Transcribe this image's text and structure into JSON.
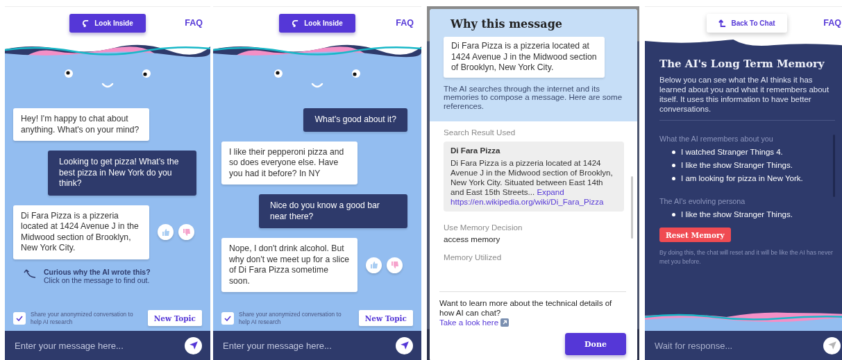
{
  "panels": [
    {
      "kind": "chat",
      "header": {
        "button": {
          "kind": "look",
          "label": "Look Inside"
        },
        "faq": "FAQ"
      },
      "messages": [
        {
          "kind": "ai",
          "text": "Hey! I'm happy to chat about anything. What's on your mind?",
          "feedback": false
        },
        {
          "kind": "user",
          "text": "Looking to get pizza! What’s the best pizza in New York do you think?",
          "feedback": false
        },
        {
          "kind": "ai",
          "text": "Di Fara Pizza is a pizzeria located at 1424 Avenue J in the Midwood section of Brooklyn, New York City.",
          "feedback": true
        }
      ],
      "hint": {
        "title": "Curious why the AI wrote this?",
        "text": "Click on the message to find out."
      },
      "share": {
        "label": "Share your anonymized conversation to help AI research",
        "checked": true
      },
      "new_topic": "New Topic",
      "input": {
        "placeholder": "Enter your message here...",
        "disabled": false
      }
    },
    {
      "kind": "chat",
      "header": {
        "button": {
          "kind": "look",
          "label": "Look Inside"
        },
        "faq": "FAQ"
      },
      "messages": [
        {
          "kind": "user",
          "text": "What's good about it?",
          "feedback": false
        },
        {
          "kind": "ai",
          "text": "I like their pepperoni pizza and so does everyone else. Have you had it before? In NY",
          "feedback": false
        },
        {
          "kind": "user",
          "text": "Nice do you know a good bar near there?",
          "feedback": false
        },
        {
          "kind": "ai",
          "text": "Nope, I don't drink alcohol. But why don't we meet up for a slice of Di Fara Pizza sometime soon.",
          "feedback": true
        }
      ],
      "share": {
        "label": "Share your anonymized conversation to help AI research",
        "checked": true
      },
      "new_topic": "New Topic",
      "input": {
        "placeholder": "Enter your message here...",
        "disabled": false
      }
    },
    {
      "kind": "why",
      "title": "Why this message",
      "quote": "Di Fara Pizza is a pizzeria located at 1424 Avenue J in the Midwood section of Brooklyn, New York City.",
      "intro": "The AI searches through the internet and its memories to compose a message. Here are some references.",
      "sections": [
        {
          "kind": "result",
          "label": "Search Result Used",
          "title": "Di Fara Pizza",
          "text": "Di Fara Pizza is a pizzeria located at 1424 Avenue J in the Midwood section of Brooklyn, New York City. Situated between East 14th and East 15th Streets...",
          "expand": "Expand",
          "url": "https://en.wikipedia.org/wiki/Di_Fara_Pizza"
        },
        {
          "kind": "value",
          "label": "Use Memory Decision",
          "value": "access memory"
        },
        {
          "kind": "label",
          "label": "Memory Utilized"
        }
      ],
      "footer": {
        "text": "Want to learn more about the technical details of how AI can chat?",
        "link": "Take a look here"
      },
      "done": "Done"
    },
    {
      "kind": "memory",
      "header": {
        "button": {
          "kind": "back",
          "label": "Back To Chat"
        },
        "faq": "FAQ"
      },
      "title": "The AI's Long Term Memory",
      "description": "Below you can see what the AI thinks it has learned about you and what it remembers about itself. It uses this information to have better conversations.",
      "sections": [
        {
          "label": "What the AI remembers about you",
          "items": [
            "I watched Stranger Things 4.",
            "I like the show Stranger Things.",
            "I am looking for pizza in New York."
          ]
        },
        {
          "label": "The AI's evolving persona",
          "items": [
            "I like the show Stranger Things."
          ]
        }
      ],
      "reset": "Reset Memory",
      "note": "By doing this, the chat will reset and it will be like the AI has never met you before.",
      "input": {
        "placeholder": "Wait for response...",
        "disabled": true
      }
    }
  ]
}
